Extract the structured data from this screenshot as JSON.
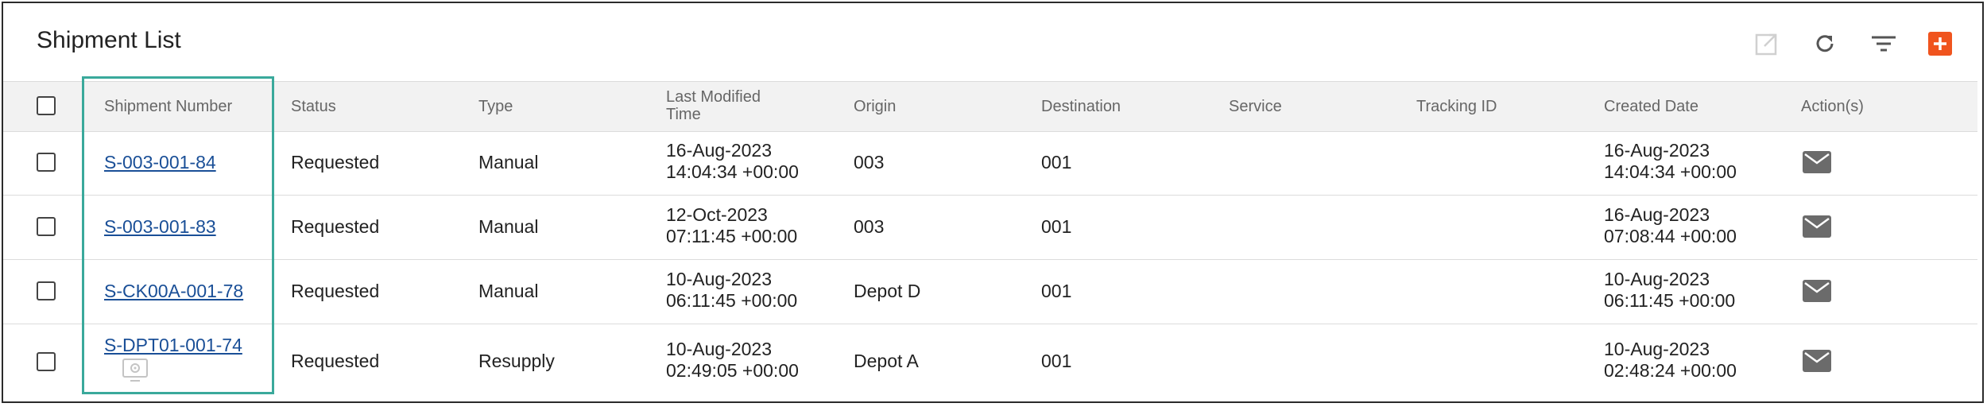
{
  "title": "Shipment List",
  "toolbar": {
    "icons": [
      "open-external-icon",
      "refresh-icon",
      "filter-icon",
      "add-icon"
    ]
  },
  "colors": {
    "accent": "#f0541e",
    "link": "#1a4f97",
    "highlight": "#3aa99b",
    "header_bg": "#f2f2f2"
  },
  "columns": [
    "Shipment Number",
    "Status",
    "Type",
    "Last Modified Time",
    "Origin",
    "Destination",
    "Service",
    "Tracking ID",
    "Created Date",
    "Action(s)"
  ],
  "rows": [
    {
      "shipment_number": "S-003-001-84",
      "status": "Requested",
      "type": "Manual",
      "last_modified_date": "16-Aug-2023",
      "last_modified_time": "14:04:34 +00:00",
      "origin": "003",
      "destination": "001",
      "service": "",
      "tracking_id": "",
      "created_date": "16-Aug-2023",
      "created_time": "14:04:34 +00:00"
    },
    {
      "shipment_number": "S-003-001-83",
      "status": "Requested",
      "type": "Manual",
      "last_modified_date": "12-Oct-2023",
      "last_modified_time": "07:11:45 +00:00",
      "origin": "003",
      "destination": "001",
      "service": "",
      "tracking_id": "",
      "created_date": "16-Aug-2023",
      "created_time": "07:08:44 +00:00"
    },
    {
      "shipment_number": "S-CK00A-001-78",
      "status": "Requested",
      "type": "Manual",
      "last_modified_date": "10-Aug-2023",
      "last_modified_time": "06:11:45 +00:00",
      "origin": "Depot D",
      "destination": "001",
      "service": "",
      "tracking_id": "",
      "created_date": "10-Aug-2023",
      "created_time": "06:11:45 +00:00"
    },
    {
      "shipment_number": "S-DPT01-001-74",
      "status": "Requested",
      "type": "Resupply",
      "last_modified_date": "10-Aug-2023",
      "last_modified_time": "02:49:05 +00:00",
      "origin": "Depot A",
      "destination": "001",
      "service": "",
      "tracking_id": "",
      "created_date": "10-Aug-2023",
      "created_time": "02:48:24 +00:00"
    }
  ]
}
